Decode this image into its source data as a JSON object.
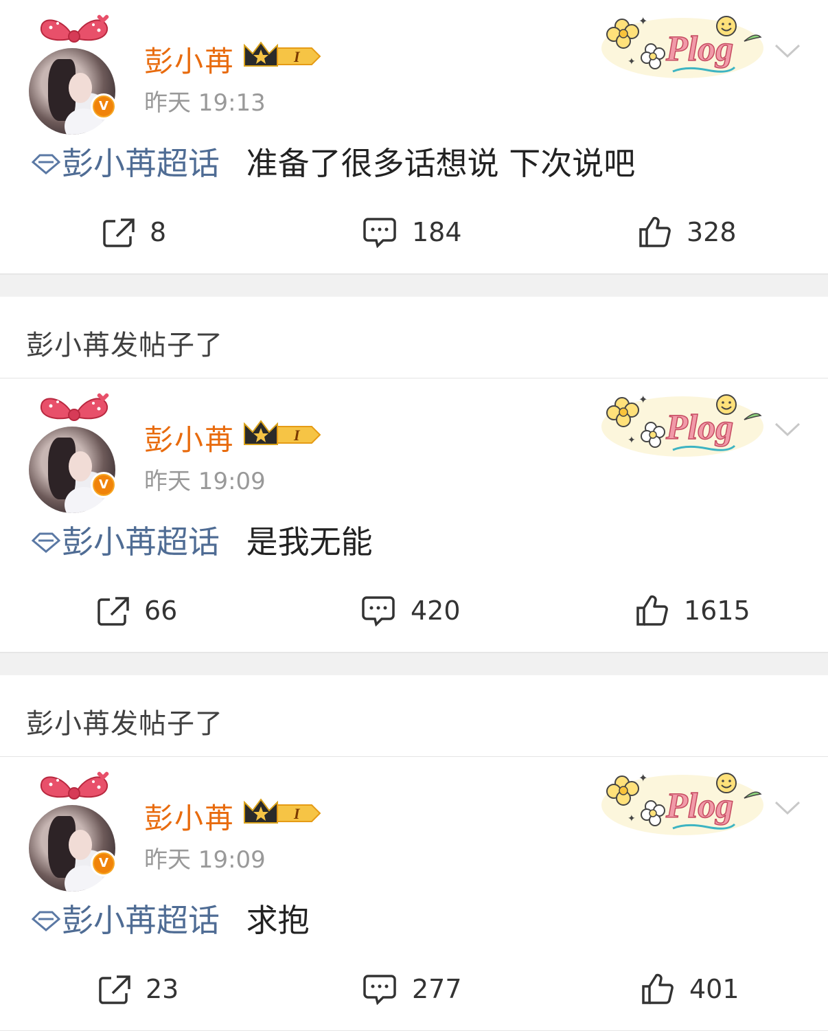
{
  "group_header_text": "彭小苒发帖子了",
  "verified_badge_text": "V",
  "level_badge_text": "I",
  "decoration_text": "Plog",
  "colors": {
    "username": "#e86b0e",
    "topic": "#4f6c94",
    "timestamp": "#999999",
    "verified_badge": "#f0830a"
  },
  "posts": [
    {
      "username": "彭小苒",
      "time": "昨天 19:13",
      "topic": "彭小苒超话",
      "text": "准备了很多话想说 下次说吧",
      "reposts": "8",
      "comments": "184",
      "likes": "328"
    },
    {
      "username": "彭小苒",
      "time": "昨天 19:09",
      "topic": "彭小苒超话",
      "text": "是我无能",
      "reposts": "66",
      "comments": "420",
      "likes": "1615"
    },
    {
      "username": "彭小苒",
      "time": "昨天 19:09",
      "topic": "彭小苒超话",
      "text": "求抱",
      "reposts": "23",
      "comments": "277",
      "likes": "401"
    }
  ],
  "icons": {
    "repost": "repost-icon",
    "comment": "comment-icon",
    "like": "thumbs-up-icon",
    "more": "chevron-down-icon",
    "topic": "super-topic-diamond-icon",
    "verified": "verified-v-icon",
    "crown": "crown-level-icon"
  }
}
